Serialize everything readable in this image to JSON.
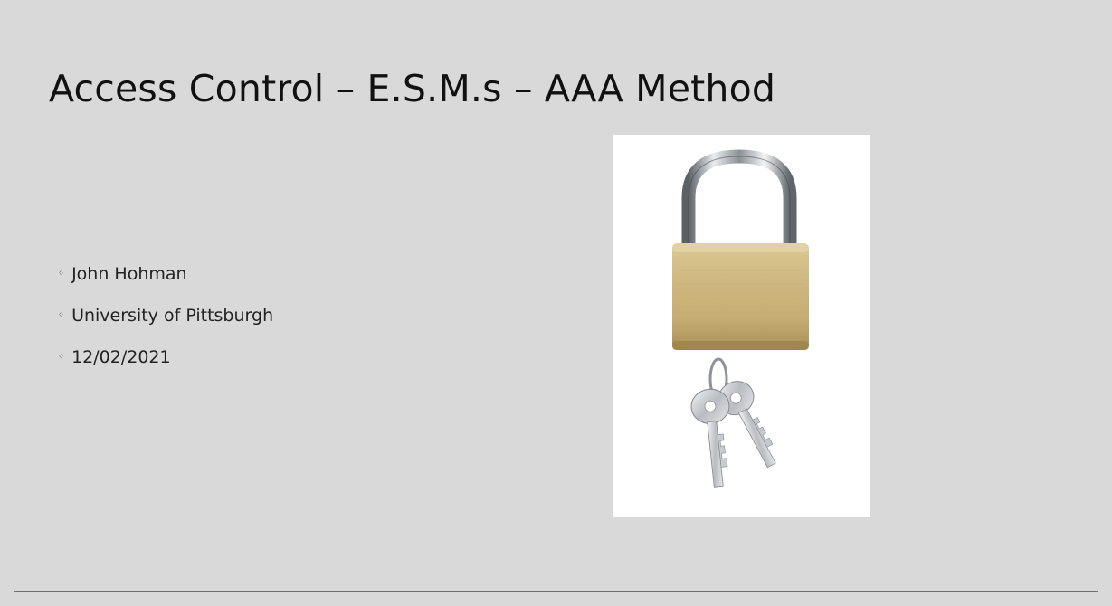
{
  "slide": {
    "title": "Access Control – E.S.M.s – AAA Method",
    "bullets": [
      {
        "marker": "◦",
        "text": "John Hohman"
      },
      {
        "marker": "◦",
        "text": "University of Pittsburgh"
      },
      {
        "marker": "◦",
        "text": "12/02/2021"
      }
    ],
    "image": {
      "icon": "padlock-with-keys-picture"
    }
  },
  "colors": {
    "background": "#d9d9d9",
    "frame": "#6f6f6f",
    "text": "#111111",
    "brass": "#cdb985"
  }
}
